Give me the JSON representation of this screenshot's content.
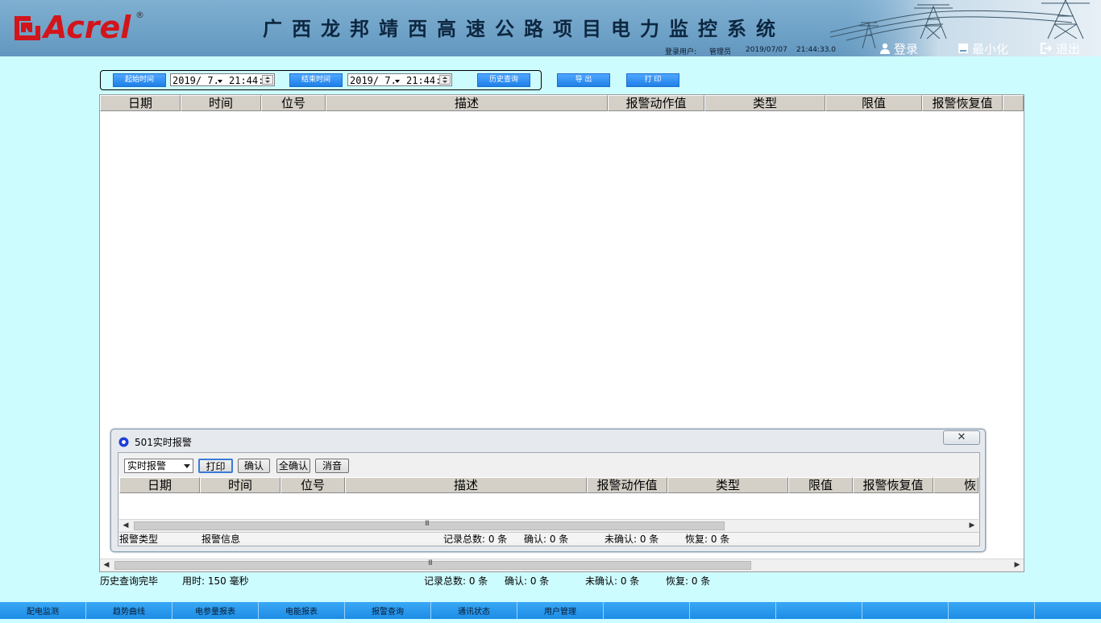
{
  "header": {
    "logo_text": "Acrel",
    "logo_reg": "®",
    "title": "广西龙邦靖西高速公路项目电力监控系统",
    "user_label": "登录用户:",
    "user_name": "管理员",
    "date": "2019/07/07",
    "time": "21:44:33.0",
    "login_label": "登录",
    "minimize_label": "最小化",
    "exit_label": "退出"
  },
  "toolbar": {
    "start_time_label": "起始时间",
    "start_date": "2019/ 7.",
    "start_time": "21:44:",
    "end_time_label": "结束时间",
    "end_date": "2019/ 7.",
    "end_time": "21:44:",
    "history_query_label": "历史查询",
    "export_label": "导 出",
    "print_label": "打 印"
  },
  "main_table": {
    "columns": [
      "日期",
      "时间",
      "位号",
      "描述",
      "报警动作值",
      "类型",
      "限值",
      "报警恢复值"
    ]
  },
  "main_status": {
    "query_status": "历史查询完毕",
    "elapsed": "用时: 150 毫秒",
    "total_records": "记录总数: 0 条",
    "confirmed": "确认: 0 条",
    "unconfirmed": "未确认: 0 条",
    "recovered": "恢复: 0 条"
  },
  "alarm_window": {
    "title": "501实时报警",
    "filter_value": "实时报警",
    "print_label": "打印",
    "confirm_label": "确认",
    "confirm_all_label": "全确认",
    "mute_label": "消音",
    "columns": [
      "日期",
      "时间",
      "位号",
      "描述",
      "报警动作值",
      "类型",
      "限值",
      "报警恢复值",
      "恢"
    ],
    "status": {
      "alarm_type": "报警类型",
      "alarm_info": "报警信息",
      "total_records": "记录总数: 0 条",
      "confirmed": "确认: 0 条",
      "unconfirmed": "未确认: 0 条",
      "recovered": "恢复: 0 条"
    }
  },
  "bottom_nav": {
    "items": [
      "配电监测",
      "趋势曲线",
      "电参量报表",
      "电能报表",
      "报警查询",
      "通讯状态",
      "用户管理",
      "",
      "",
      "",
      "",
      "",
      ""
    ]
  },
  "colors": {
    "background": "#cdfcff",
    "header": "#6fa2c7",
    "logo_red": "#d2151b",
    "nav_blue": "#1d8de6",
    "button_blue": "#1e7fe6"
  }
}
